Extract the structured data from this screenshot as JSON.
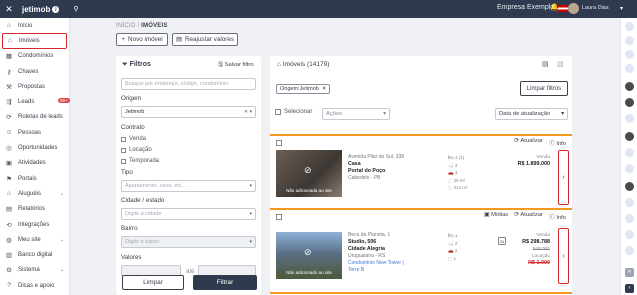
{
  "topbar": {
    "logo": "jetimob",
    "company": "Empresa Exemplo",
    "user": "Laura Dias"
  },
  "sidebar": {
    "items": [
      {
        "label": "Início",
        "icon": "home-icon"
      },
      {
        "label": "Imóveis",
        "icon": "house-icon"
      },
      {
        "label": "Condomínios",
        "icon": "building-icon"
      },
      {
        "label": "Chaves",
        "icon": "key-icon"
      },
      {
        "label": "Propostas",
        "icon": "hammer-icon"
      },
      {
        "label": "Leads",
        "icon": "leads-icon",
        "badge": "99+"
      },
      {
        "label": "Roletas de leads",
        "icon": "roulette-icon"
      },
      {
        "label": "Pessoas",
        "icon": "people-icon"
      },
      {
        "label": "Oportunidades",
        "icon": "opportunity-icon"
      },
      {
        "label": "Atividades",
        "icon": "calendar-icon"
      },
      {
        "label": "Portais",
        "icon": "flag-icon"
      },
      {
        "label": "Aluguéis",
        "icon": "rent-icon"
      },
      {
        "label": "Relatórios",
        "icon": "report-icon"
      },
      {
        "label": "Integrações",
        "icon": "integration-icon"
      },
      {
        "label": "Meu site",
        "icon": "globe-icon"
      },
      {
        "label": "Banco digital",
        "icon": "bank-icon"
      },
      {
        "label": "Sistema",
        "icon": "gear-icon"
      },
      {
        "label": "Dicas e apoio",
        "icon": "help-icon"
      }
    ]
  },
  "breadcrumb": {
    "home": "INÍCIO",
    "sep": "/",
    "current": "IMÓVEIS"
  },
  "actions": {
    "new": "Novo imóvel",
    "readjust": "Reajustar valores"
  },
  "filters": {
    "title": "Filtros",
    "save": "Salvar filtro",
    "search_placeholder": "Busque por endereço, código, condomínio",
    "origem_label": "Origem",
    "origem_value": "Jetimob",
    "contrato_label": "Contrato",
    "contrato_options": [
      "Venda",
      "Locação",
      "Temporada"
    ],
    "tipo_label": "Tipo",
    "tipo_placeholder": "Apartamento, casa, etc...",
    "cidade_label": "Cidade / estado",
    "cidade_placeholder": "Digite a cidade",
    "bairro_label": "Bairro",
    "bairro_placeholder": "Digite o bairro",
    "valores_label": "Valores",
    "ate": "até",
    "clear": "Limpar",
    "apply": "Filtrar"
  },
  "results": {
    "title": "Imóveis (14179)",
    "chip": "Origem:Jetimob",
    "clear_filters": "Limpar filtros",
    "select": "Selecionar",
    "actions": "Ações",
    "sort": "Data de atualização",
    "cards": [
      {
        "address": "Avenida Pilar do Sul, 338",
        "type": "Casa",
        "neighborhood": "Portal do Poço",
        "city": "Cabedelo - PB",
        "no_photo": "Não adicionada ao site",
        "specs": [
          "4 (1)",
          "3",
          "3",
          "35 m²",
          "314 m²"
        ],
        "price_label": "Venda",
        "price": "R$ 1.899.000",
        "update": "Atualizar",
        "info": "Info"
      },
      {
        "address": "Beco da Planeta, 1",
        "type": "Studio, 506",
        "neighborhood": "Cidade Alegria",
        "city": "Uruguaiana - RS",
        "link1": "Condomínio New Tower |",
        "link2": "Torre B",
        "no_photo": "Não adicionado ao site",
        "specs": [
          "1",
          "2",
          "2",
          "1"
        ],
        "price_label": "Venda",
        "price": "R$ 298.788",
        "old_price": "549.000",
        "rent_label": "Locação",
        "rent": "R$ 1.000",
        "media": "Mídias",
        "update": "Atualizar",
        "info": "Info"
      }
    ]
  }
}
